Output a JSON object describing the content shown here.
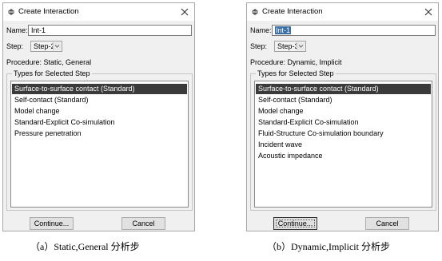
{
  "dialogs": {
    "a": {
      "title": "Create Interaction",
      "name_label": "Name:",
      "name_value": "Int-1",
      "step_label": "Step:",
      "step_value": "Step-2",
      "procedure_label": "Procedure:",
      "procedure_value": "Static, General",
      "types_title": "Types for Selected Step",
      "types": [
        "Surface-to-surface contact (Standard)",
        "Self-contact (Standard)",
        "Model change",
        "Standard-Explicit Co-simulation",
        "Pressure penetration"
      ],
      "continue_label": "Continue...",
      "cancel_label": "Cancel"
    },
    "b": {
      "title": "Create Interaction",
      "name_label": "Name:",
      "name_value": "Int-1",
      "step_label": "Step:",
      "step_value": "Step-3",
      "procedure_label": "Procedure:",
      "procedure_value": "Dynamic, Implicit",
      "types_title": "Types for Selected Step",
      "types": [
        "Surface-to-surface contact (Standard)",
        "Self-contact (Standard)",
        "Model change",
        "Standard-Explicit Co-simulation",
        "Fluid-Structure Co-simulation boundary",
        "Incident wave",
        "Acoustic impedance"
      ],
      "continue_label": "Continue...",
      "cancel_label": "Cancel"
    }
  },
  "captions": {
    "a": "（a）Static,General 分析步",
    "b": "（b）Dynamic,Implicit 分析步"
  },
  "icons": {
    "app": "abaqus-interaction-icon",
    "close": "close-icon",
    "dropdown": "chevron-down-icon"
  },
  "colors": {
    "dialog_bg": "#f0f0f0",
    "list_selected_bg": "#3b3b3b",
    "text_selection_bg": "#3a6ea5"
  }
}
